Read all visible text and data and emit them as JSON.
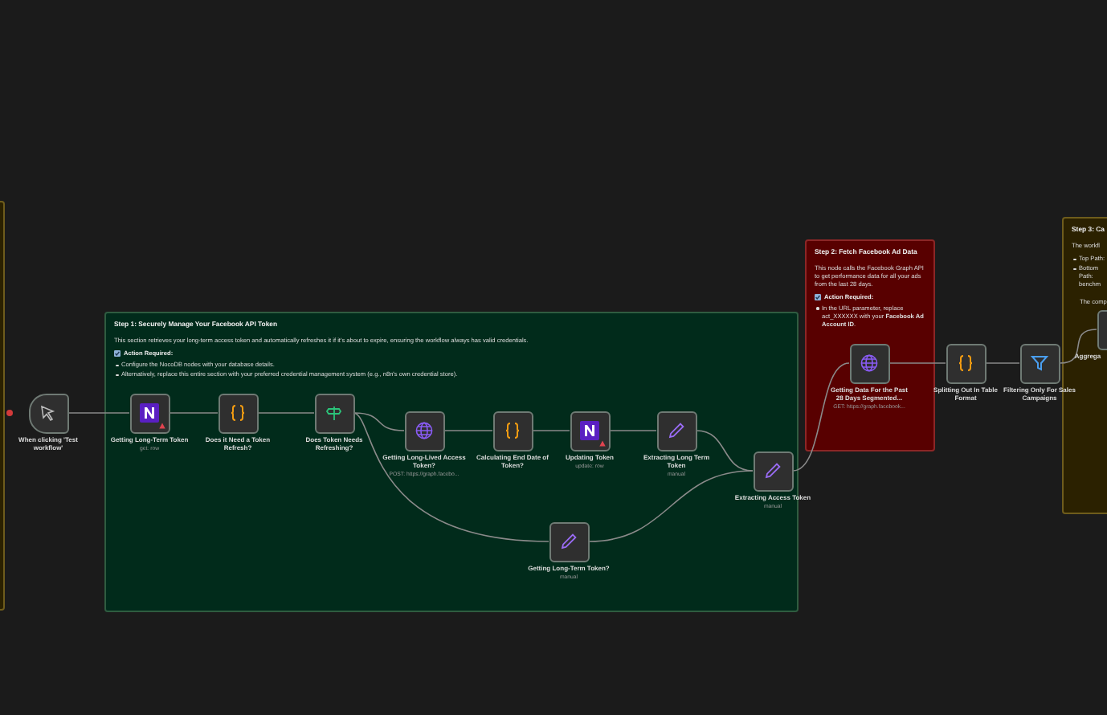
{
  "sticky_notes": [
    {
      "kind": "yellow"
    },
    {
      "kind": "green",
      "title": "Step 1: Securely Manage Your Facebook API Token",
      "body": "This section retrieves your long-term access token and automatically refreshes it if it's about to expire, ensuring the workflow always has valid credentials.",
      "action": "Action Required:",
      "bullets": [
        "Configure the NocoDB nodes with your database details.",
        "Alternatively, replace this entire section with your preferred credential management system (e.g., n8n's own credential store)."
      ]
    },
    {
      "kind": "red",
      "title": "Step 2: Fetch Facebook Ad Data",
      "body": "This node calls the Facebook Graph API to get performance data for all your ads from the last 28 days.",
      "action": "Action Required:",
      "bullets": [
        "In the URL parameter, replace act_XXXXXX with your **Facebook Ad Account ID**."
      ]
    },
    {
      "kind": "yellow",
      "title": "Step 3: Ca",
      "body": "The workfl",
      "bullets": [
        "Top Path:",
        "Bottom Path: benchm"
      ],
      "footer": "The comp"
    }
  ],
  "nodes": [
    {
      "kind": "trigger",
      "label": "When clicking 'Test workflow'",
      "warning": false
    },
    {
      "kind": "nocodb",
      "label": "Getting Long-Term Token",
      "subtitle": "get: row",
      "warning": true
    },
    {
      "kind": "code",
      "label": "Does it Need a Token Refresh?",
      "warning": false
    },
    {
      "kind": "if",
      "label": "Does Token Needs Refreshing?",
      "warning": false
    },
    {
      "kind": "http",
      "label": "Getting Long-Lived Access Token?",
      "subtitle": "POST: https://graph.facebo...",
      "warning": false
    },
    {
      "kind": "code",
      "label": "Calculating End Date of Token?",
      "warning": false
    },
    {
      "kind": "nocodb",
      "label": "Updating Token",
      "subtitle": "update: row",
      "warning": true
    },
    {
      "kind": "set",
      "label": "Extracting Long Term Token",
      "subtitle": "manual",
      "warning": false
    },
    {
      "kind": "set",
      "label": "Extracting Access Token",
      "subtitle": "manual",
      "warning": false
    },
    {
      "kind": "set",
      "label": "Getting Long-Term Token?",
      "subtitle": "manual",
      "warning": false
    },
    {
      "kind": "http",
      "label": "Getting Data For the Past 28 Days Segmented...",
      "subtitle": "GET: https://graph.facebook...",
      "warning": false
    },
    {
      "kind": "code",
      "label": "Splitting Out In Table Format",
      "warning": false
    },
    {
      "kind": "filter",
      "label": "Filtering Only For Sales Campaigns",
      "warning": false
    },
    {
      "kind": "code",
      "label": "Aggrega",
      "warning": false
    }
  ]
}
